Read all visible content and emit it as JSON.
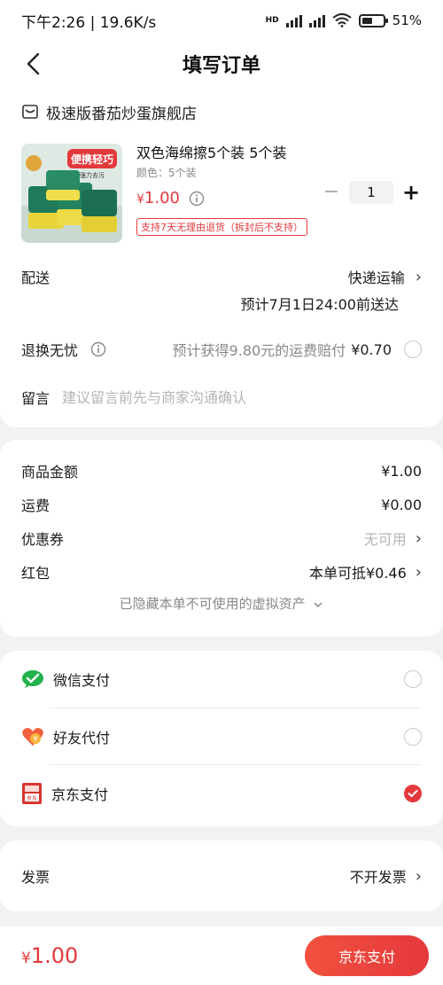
{
  "status_bar": {
    "time_speed": "下午2:26 | 19.6K/s",
    "network": "HD",
    "battery_percent": "51%",
    "battery_level": 0.51
  },
  "nav": {
    "title": "填写订单"
  },
  "store": {
    "name": "极速版番茄炒蛋旗舰店",
    "product": {
      "image_badge": "便携轻巧",
      "image_subtext": "强力去污",
      "title": "双色海绵擦5个装 5个装",
      "spec": "颜色：5个装",
      "price_symbol": "¥",
      "price_value": "1.00",
      "quantity": "1",
      "minus_label": "−",
      "plus_label": "+",
      "return_policy": "支持7天无理由退货（拆封后不支持）"
    },
    "delivery": {
      "label": "配送",
      "method": "快递运输",
      "eta": "预计7月1日24:00前送达"
    },
    "worry_free": {
      "label": "退换无忧",
      "info": "i",
      "description": "预计获得9.80元的运费赔付",
      "price": "¥0.70"
    },
    "remark": {
      "label": "留言",
      "placeholder": "建议留言前先与商家沟通确认"
    }
  },
  "amounts": {
    "rows": [
      {
        "label": "商品金额",
        "value": "¥1.00"
      },
      {
        "label": "运费",
        "value": "¥0.00"
      },
      {
        "label": "优惠券",
        "value": "无可用"
      },
      {
        "label": "红包",
        "value": "本单可抵¥0.46"
      }
    ],
    "hidden_assets": "已隐藏本单不可使用的虚拟资产"
  },
  "payment": {
    "options": [
      {
        "label": "微信支付",
        "icon": "wechat-pay-icon",
        "selected": false
      },
      {
        "label": "好友代付",
        "icon": "friend-pay-icon",
        "selected": false
      },
      {
        "label": "京东支付",
        "icon": "jd-pay-icon",
        "icon_text": "京东",
        "selected": true
      }
    ]
  },
  "invoice": {
    "label": "发票",
    "value": "不开发票"
  },
  "bottom": {
    "total_symbol": "¥",
    "total_value": "1.00",
    "submit_label": "京东支付"
  },
  "colors": {
    "accent": "#e4393c",
    "wechat": "#22b14c",
    "sponge_yellow": "#e8d43a",
    "sponge_green": "#1f7a5a"
  }
}
